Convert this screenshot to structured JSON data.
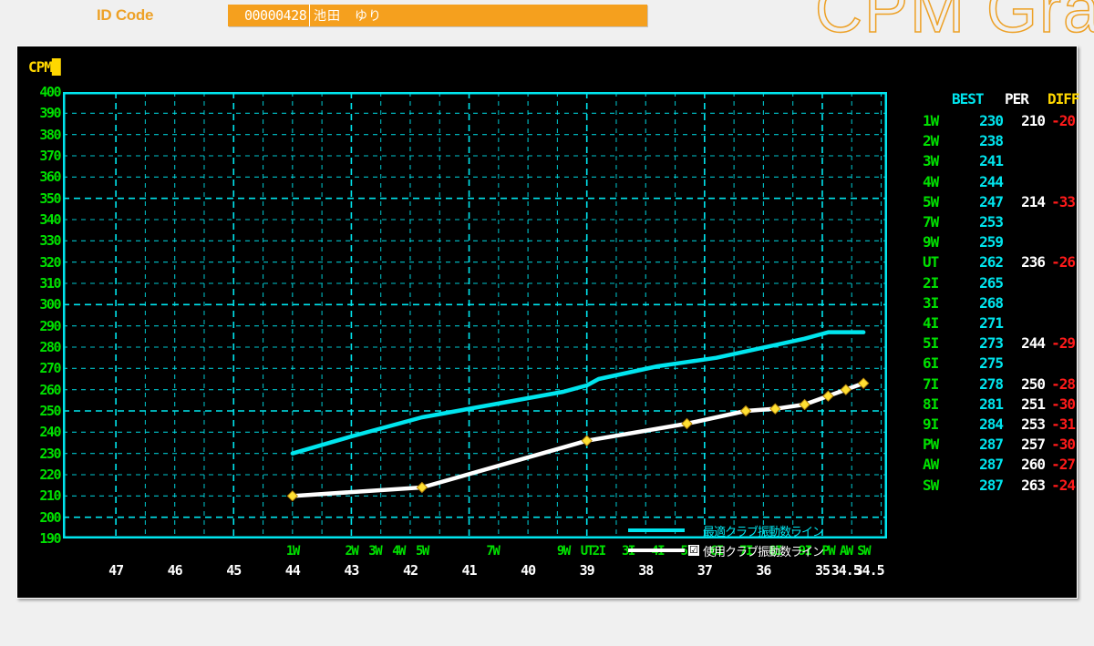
{
  "header": {
    "watermark_title": "CPM Gra",
    "id_code_label": "ID Code",
    "id_number": "00000428",
    "id_name": "池田　ゆり",
    "accent_color": "#f5a01e"
  },
  "panel": {
    "axis_unit_label": "CPM",
    "bg_color": "#000000",
    "grid_color": "#00e5ee"
  },
  "legend": {
    "optimal_label": "最適クラブ振動数ライン",
    "optimal_color": "#00e5ee",
    "used_label": "使用クラブ振動数ライン",
    "used_color": "#ffffff",
    "used_checked": "☑"
  },
  "table": {
    "headers": {
      "club": "",
      "best": "BEST",
      "per": "PER",
      "diff": "DIFF"
    },
    "rows": [
      {
        "club": "1W",
        "best": "230",
        "per": "210",
        "diff": "-20"
      },
      {
        "club": "2W",
        "best": "238",
        "per": "",
        "diff": ""
      },
      {
        "club": "3W",
        "best": "241",
        "per": "",
        "diff": ""
      },
      {
        "club": "4W",
        "best": "244",
        "per": "",
        "diff": ""
      },
      {
        "club": "5W",
        "best": "247",
        "per": "214",
        "diff": "-33"
      },
      {
        "club": "7W",
        "best": "253",
        "per": "",
        "diff": ""
      },
      {
        "club": "9W",
        "best": "259",
        "per": "",
        "diff": ""
      },
      {
        "club": "UT",
        "best": "262",
        "per": "236",
        "diff": "-26"
      },
      {
        "club": "2I",
        "best": "265",
        "per": "",
        "diff": ""
      },
      {
        "club": "3I",
        "best": "268",
        "per": "",
        "diff": ""
      },
      {
        "club": "4I",
        "best": "271",
        "per": "",
        "diff": ""
      },
      {
        "club": "5I",
        "best": "273",
        "per": "244",
        "diff": "-29"
      },
      {
        "club": "6I",
        "best": "275",
        "per": "",
        "diff": ""
      },
      {
        "club": "7I",
        "best": "278",
        "per": "250",
        "diff": "-28"
      },
      {
        "club": "8I",
        "best": "281",
        "per": "251",
        "diff": "-30"
      },
      {
        "club": "9I",
        "best": "284",
        "per": "253",
        "diff": "-31"
      },
      {
        "club": "PW",
        "best": "287",
        "per": "257",
        "diff": "-30"
      },
      {
        "club": "AW",
        "best": "287",
        "per": "260",
        "diff": "-27"
      },
      {
        "club": "SW",
        "best": "287",
        "per": "263",
        "diff": "-24"
      }
    ]
  },
  "chart_data": {
    "type": "line",
    "title": "CPM Graph",
    "xlabel": "",
    "ylabel": "CPM",
    "ylim": [
      190,
      400
    ],
    "ytick_step": 10,
    "yticks": [
      400,
      390,
      380,
      370,
      360,
      350,
      340,
      330,
      320,
      310,
      300,
      290,
      280,
      270,
      260,
      250,
      240,
      230,
      220,
      210,
      200,
      190
    ],
    "grid": true,
    "legend_position": "inside-bottom-right",
    "x_club_labels": [
      "1W",
      "2W",
      "3W",
      "4W",
      "5W",
      "7W",
      "9W",
      "UT",
      "2I",
      "3I",
      "4I",
      "5I",
      "6I",
      "7I",
      "8I",
      "9I",
      "PW",
      "AW",
      "SW"
    ],
    "x_club_positions": [
      44,
      43,
      42.6,
      42.2,
      41.8,
      40.6,
      39.4,
      39.0,
      38.8,
      38.3,
      37.8,
      37.3,
      36.8,
      36.3,
      35.8,
      35.3,
      34.9,
      34.6,
      34.3
    ],
    "x_length_labels": [
      "47",
      "46",
      "45",
      "44",
      "43",
      "42",
      "41",
      "40",
      "39",
      "38",
      "37",
      "36",
      "35",
      "34.5",
      "34.5"
    ],
    "x_length_positions": [
      47,
      46,
      45,
      44,
      43,
      42,
      41,
      40,
      39,
      38,
      37,
      36,
      35,
      34.6,
      34.2
    ],
    "xlim": [
      47.9,
      33.9
    ],
    "series": [
      {
        "name": "最適クラブ振動数ライン",
        "color": "#00e5ee",
        "markers": false,
        "x": [
          44,
          43,
          42.6,
          42.2,
          41.8,
          40.6,
          39.4,
          39.0,
          38.8,
          38.3,
          37.8,
          37.3,
          36.8,
          36.3,
          35.8,
          35.3,
          34.9,
          34.6,
          34.3
        ],
        "values": [
          230,
          238,
          241,
          244,
          247,
          253,
          259,
          262,
          265,
          268,
          271,
          273,
          275,
          278,
          281,
          284,
          287,
          287,
          287
        ]
      },
      {
        "name": "使用クラブ振動数ライン",
        "color": "#ffffff",
        "marker_color": "#ffe033",
        "markers": true,
        "x": [
          44,
          41.8,
          39.0,
          37.3,
          36.3,
          35.8,
          35.3,
          34.9,
          34.6,
          34.3
        ],
        "values": [
          210,
          214,
          236,
          244,
          250,
          251,
          253,
          257,
          260,
          263
        ]
      }
    ]
  }
}
